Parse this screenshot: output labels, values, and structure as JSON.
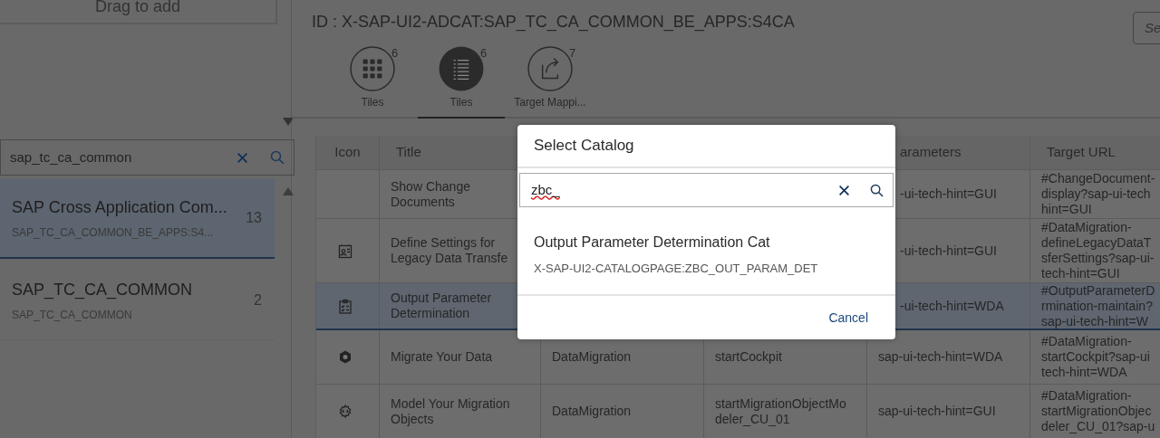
{
  "left_panel": {
    "drag_card": {
      "label": "Drag to add"
    },
    "search": {
      "value": "sap_tc_ca_common"
    },
    "catalogs": [
      {
        "title": "SAP Cross Application Com...",
        "subtitle": "SAP_TC_CA_COMMON_BE_APPS:S4...",
        "count": "13",
        "selected": true
      },
      {
        "title": "SAP_TC_CA_COMMON",
        "subtitle": "SAP_TC_CA_COMMON",
        "count": "2",
        "selected": false
      }
    ]
  },
  "header": {
    "id_text": "ID : X-SAP-UI2-ADCAT:SAP_TC_CA_COMMON_BE_APPS:S4CA",
    "search": {
      "placeholder": "Se"
    }
  },
  "tabs": [
    {
      "kind": "grid",
      "label": "Tiles",
      "count": "6",
      "selected": false
    },
    {
      "kind": "list",
      "label": "Tiles",
      "count": "6",
      "selected": true
    },
    {
      "kind": "share",
      "label": "Target Mappi...",
      "count": "7",
      "selected": false
    }
  ],
  "table": {
    "columns": [
      "Icon",
      "Title",
      "",
      "",
      "arameters",
      "Target URL"
    ],
    "rows": [
      {
        "kind": "none",
        "selected": false,
        "cells": [
          "",
          "Show Change Documents",
          "",
          "",
          "-ui-tech-hint=GUI",
          "#ChangeDocument-\ndisplay?sap-ui-tech\nhint=GUI"
        ]
      },
      {
        "kind": "card",
        "selected": false,
        "cells": [
          "",
          "Define Settings for Legacy Data Transfe",
          "",
          "",
          "-ui-tech-hint=GUI",
          "#DataMigration-\ndefineLegacyDataT\nsferSettings?sap-ui-\ntech-hint=GUI"
        ]
      },
      {
        "kind": "checklist",
        "selected": true,
        "cells": [
          "",
          "Output Parameter Determination",
          "",
          "",
          "-ui-tech-hint=WDA",
          "#OutputParameterD\nrmination-maintain?\nsap-ui-tech-hint=W"
        ]
      },
      {
        "kind": "cube",
        "selected": false,
        "cells": [
          "",
          "Migrate Your Data",
          "DataMigration",
          "startCockpit",
          "sap-ui-tech-hint=WDA",
          "#DataMigration-\nstartCockpit?sap-ui\ntech-hint=WDA"
        ]
      },
      {
        "kind": "gear",
        "selected": false,
        "cells": [
          "",
          "Model Your Migration Objects",
          "DataMigration",
          "startMigrationObjectMo deler_CU_01",
          "sap-ui-tech-hint=GUI",
          "#DataMigration-\nstartMigrationObjec\ndeler_CU_01?sap-u"
        ]
      }
    ]
  },
  "dialog": {
    "title": "Select Catalog",
    "search": {
      "value": "zbc_"
    },
    "results": [
      {
        "title": "Output Parameter Determination Cat",
        "subtitle": "X-SAP-UI2-CATALOGPAGE:ZBC_OUT_PARAM_DET"
      }
    ],
    "buttons": [
      "Cancel"
    ]
  }
}
